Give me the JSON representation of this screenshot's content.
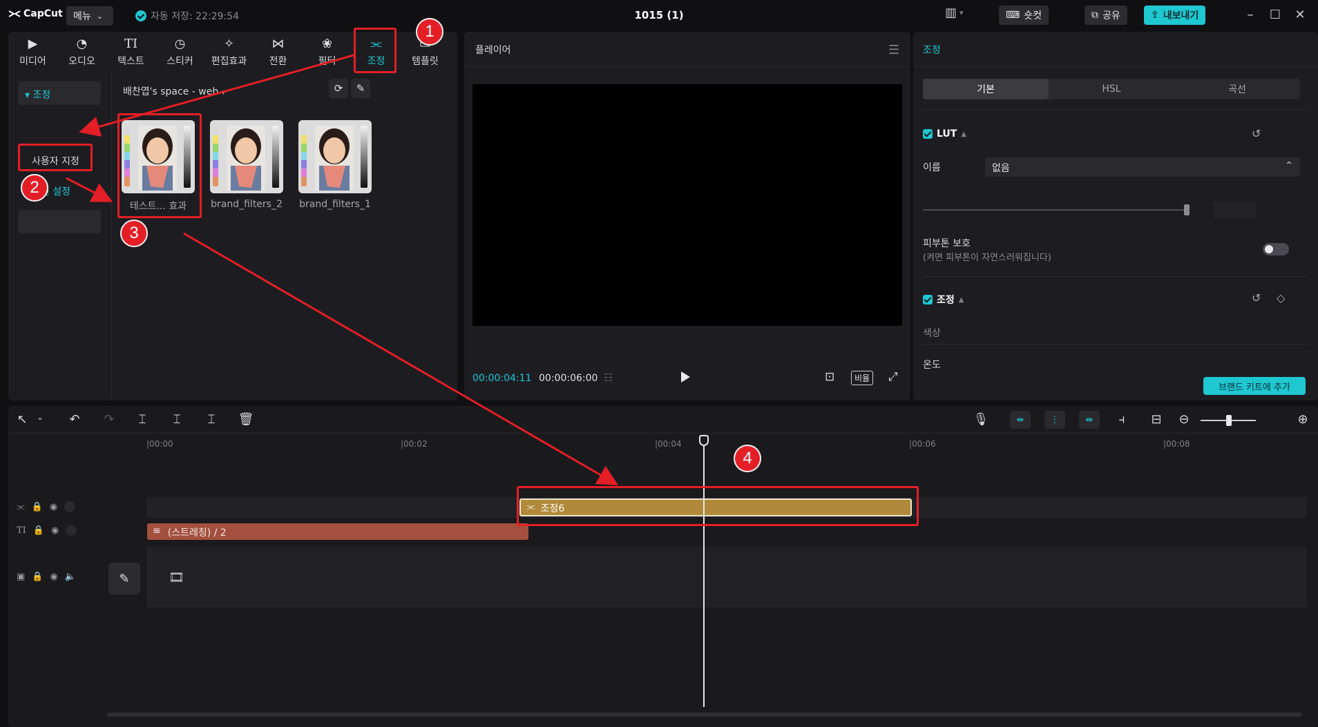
{
  "app": {
    "logo_text": "CapCut",
    "menu_label": "메뉴",
    "autosave_text": "자동 저장: 22:29:54",
    "project_title": "1015 (1)",
    "shortcut_label": "숏컷",
    "share_label": "공유",
    "export_label": "내보내기"
  },
  "media_tabs": [
    {
      "label": "미디어",
      "icon": "media-icon"
    },
    {
      "label": "오디오",
      "icon": "audio-icon"
    },
    {
      "label": "텍스트",
      "icon": "text-icon"
    },
    {
      "label": "스티커",
      "icon": "sticker-icon"
    },
    {
      "label": "편집효과",
      "icon": "effects-icon"
    },
    {
      "label": "전환",
      "icon": "transition-icon"
    },
    {
      "label": "필터",
      "icon": "filter-icon"
    },
    {
      "label": "조정",
      "icon": "adjust-icon",
      "active": true
    },
    {
      "label": "템플릿",
      "icon": "template-icon"
    }
  ],
  "sidebar": {
    "header": "▾ 조정",
    "items": [
      "사용자 지정",
      "사전 설정"
    ],
    "selected": "사전 설정"
  },
  "library": {
    "space_label": "배찬엽's space - web",
    "presets": [
      "테스트... 효과",
      "brand_filters_2",
      "brand_filters_1"
    ]
  },
  "player": {
    "title": "플레이어",
    "current_time": "00:00:04:11",
    "total_time": "00:00:06:00",
    "ratio_label": "비율"
  },
  "properties": {
    "title": "조정",
    "tabs": [
      "기본",
      "HSL",
      "곡선"
    ],
    "active_tab": "기본",
    "lut_title": "LUT",
    "name_label": "이름",
    "name_value": "없음",
    "skin_title": "피부톤 보호",
    "skin_desc": "(켜면 피부톤이 자연스러워집니다)",
    "skin_enabled": false,
    "adjust_title": "조정",
    "color_label": "색상",
    "temperature_label": "온도",
    "brand_kit_button": "브랜드 키트에 추가"
  },
  "timeline": {
    "ruler": [
      "|00:00",
      "|00:02",
      "|00:04",
      "|00:06",
      "|00:08"
    ],
    "adjust_clip_label": "조정6",
    "text_clip_label": "(스트레칭)  / 2",
    "playhead_time": "00:00:04:11"
  },
  "annotations": {
    "color": "#e41e26",
    "steps": [
      "1",
      "2",
      "3",
      "4"
    ]
  },
  "colors": {
    "accent": "#1fc7d1",
    "adjust_clip": "#b08a3a",
    "text_clip": "#a3503e"
  }
}
